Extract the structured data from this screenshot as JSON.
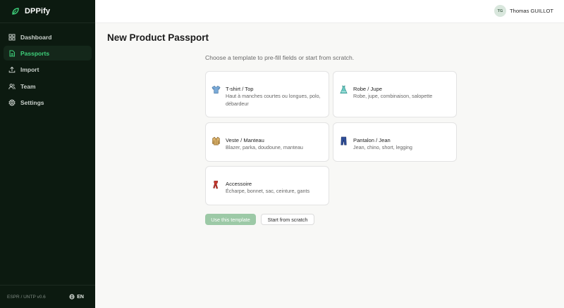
{
  "app": {
    "name": "DPPify"
  },
  "sidebar": {
    "items": [
      {
        "label": "Dashboard",
        "icon": "grid-icon",
        "active": false
      },
      {
        "label": "Passports",
        "icon": "document-icon",
        "active": true
      },
      {
        "label": "Import",
        "icon": "upload-icon",
        "active": false
      },
      {
        "label": "Team",
        "icon": "users-icon",
        "active": false
      },
      {
        "label": "Settings",
        "icon": "gear-icon",
        "active": false
      }
    ],
    "footer": {
      "version": "ESPR / UNTP v0.6",
      "language": "EN"
    }
  },
  "header": {
    "user_initials": "TG",
    "user_name": "Thomas GUILLOT"
  },
  "main": {
    "title": "New Product Passport",
    "subtitle": "Choose a template to pre-fill fields or start from scratch.",
    "templates": [
      {
        "title": "T-shirt / Top",
        "description": "Haut à manches courtes ou longues, polo, débardeur",
        "icon": "tshirt-icon"
      },
      {
        "title": "Robe / Jupe",
        "description": "Robe, jupe, combinaison, salopette",
        "icon": "dress-icon"
      },
      {
        "title": "Veste / Manteau",
        "description": "Blazer, parka, doudoune, manteau",
        "icon": "coat-icon"
      },
      {
        "title": "Pantalon / Jean",
        "description": "Jean, chino, short, legging",
        "icon": "jeans-icon"
      },
      {
        "title": "Accessoire",
        "description": "Écharpe, bonnet, sac, ceinture, gants",
        "icon": "scarf-icon"
      }
    ],
    "buttons": {
      "use_template": "Use this template",
      "start_scratch": "Start from scratch"
    }
  },
  "colors": {
    "sidebar_bg": "#0c1a10",
    "accent": "#3ecf7a",
    "primary_button": "#9cc9a6"
  }
}
